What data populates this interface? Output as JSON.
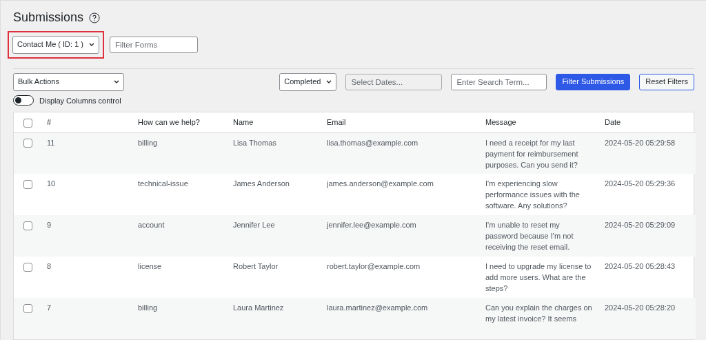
{
  "page_title": "Submissions",
  "form_select": {
    "value": "Contact Me ( ID: 1 )",
    "highlighted": true
  },
  "form_filter": {
    "placeholder": "Filter Forms"
  },
  "bulk_actions": {
    "value": "Bulk Actions"
  },
  "status_select": {
    "value": "Completed"
  },
  "date_field": {
    "placeholder": "Select Dates...",
    "disabled": true
  },
  "search_field": {
    "placeholder": "Enter Search Term..."
  },
  "buttons": [
    {
      "label": "Filter Submissions",
      "kind": "primary"
    },
    {
      "label": "Reset Filters",
      "kind": "secondary"
    }
  ],
  "columns_toggle": {
    "label": "Display Columns control",
    "on": false
  },
  "table": {
    "select_all": {
      "checked": false
    },
    "columns": [
      "#",
      "How can we help?",
      "Name",
      "Email",
      "Message",
      "Date"
    ],
    "rows": [
      {
        "checked": false,
        "cells": [
          "11",
          "billing",
          "Lisa Thomas",
          "lisa.thomas@example.com",
          "I need a receipt for my last payment for reimbursement purposes. Can you send it?",
          "2024-05-20 05:29:58"
        ]
      },
      {
        "checked": false,
        "cells": [
          "10",
          "technical-issue",
          "James Anderson",
          "james.anderson@example.com",
          "I'm experiencing slow performance issues with the software. Any solutions?",
          "2024-05-20 05:29:36"
        ]
      },
      {
        "checked": false,
        "cells": [
          "9",
          "account",
          "Jennifer Lee",
          "jennifer.lee@example.com",
          "I'm unable to reset my password because I'm not receiving the reset email.",
          "2024-05-20 05:29:09"
        ]
      },
      {
        "checked": false,
        "cells": [
          "8",
          "license",
          "Robert Taylor",
          "robert.taylor@example.com",
          "I need to upgrade my license to add more users. What are the steps?",
          "2024-05-20 05:28:43"
        ]
      },
      {
        "checked": false,
        "cells": [
          "7",
          "billing",
          "Laura Martinez",
          "laura.martinez@example.com",
          "Can you explain the charges on my latest invoice? It seems",
          "2024-05-20 05:28:20"
        ]
      }
    ]
  }
}
